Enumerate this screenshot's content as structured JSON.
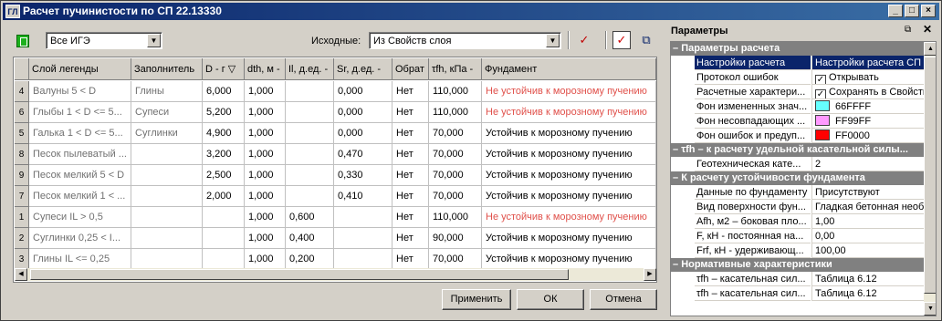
{
  "window": {
    "title": "Расчет пучинистости по СП 22.13330",
    "app_icon": "ГЛ"
  },
  "toolbar": {
    "ige_select": "Все ИГЭ",
    "source_label": "Исходные:",
    "source_select": "Из Свойств слоя"
  },
  "table": {
    "headers": [
      "Слой легенды",
      "Заполнитель",
      "D - г ▽",
      "dth, м -",
      "Il, д.ед. -",
      "Sr, д.ед. -",
      "Обрат",
      "τfh, кПа -",
      "Фундамент"
    ],
    "rows": [
      {
        "n": "4",
        "layer": "Валуны 5 < D",
        "filler": "Глины",
        "d": "6,000",
        "dth": "1,000",
        "il": "",
        "sr": "0,000",
        "obr": "Нет",
        "tfh": "110,000",
        "fund": "Не устойчив к морозному пучению",
        "fund_red": true
      },
      {
        "n": "6",
        "layer": "Глыбы 1 < D <= 5...",
        "filler": "Супеси",
        "d": "5,200",
        "dth": "1,000",
        "il": "",
        "sr": "0,000",
        "obr": "Нет",
        "tfh": "110,000",
        "fund": "Не устойчив к морозному пучению",
        "fund_red": true
      },
      {
        "n": "5",
        "layer": "Галька 1 < D <= 5...",
        "filler": "Суглинки",
        "d": "4,900",
        "dth": "1,000",
        "il": "",
        "sr": "0,000",
        "obr": "Нет",
        "tfh": "70,000",
        "fund": "Устойчив к морозному пучению",
        "fund_red": false
      },
      {
        "n": "8",
        "layer": "Песок пылеватый ...",
        "filler": "",
        "d": "3,200",
        "dth": "1,000",
        "il": "",
        "sr": "0,470",
        "obr": "Нет",
        "tfh": "70,000",
        "fund": "Устойчив к морозному пучению",
        "fund_red": false
      },
      {
        "n": "9",
        "layer": "Песок мелкий 5 < D",
        "filler": "",
        "d": "2,500",
        "dth": "1,000",
        "il": "",
        "sr": "0,330",
        "obr": "Нет",
        "tfh": "70,000",
        "fund": "Устойчив к морозному пучению",
        "fund_red": false
      },
      {
        "n": "7",
        "layer": "Песок мелкий 1 < ...",
        "filler": "",
        "d": "2,000",
        "dth": "1,000",
        "il": "",
        "sr": "0,410",
        "obr": "Нет",
        "tfh": "70,000",
        "fund": "Устойчив к морозному пучению",
        "fund_red": false
      },
      {
        "n": "1",
        "layer": "Супеси IL > 0,5",
        "filler": "",
        "d": "",
        "dth": "1,000",
        "il": "0,600",
        "sr": "",
        "obr": "Нет",
        "tfh": "110,000",
        "fund": "Не устойчив к морозному пучению",
        "fund_red": true
      },
      {
        "n": "2",
        "layer": "Суглинки 0,25 < I...",
        "filler": "",
        "d": "",
        "dth": "1,000",
        "il": "0,400",
        "sr": "",
        "obr": "Нет",
        "tfh": "90,000",
        "fund": "Устойчив к морозному пучению",
        "fund_red": false
      },
      {
        "n": "3",
        "layer": "Глины IL <= 0,25",
        "filler": "",
        "d": "",
        "dth": "1,000",
        "il": "0,200",
        "sr": "",
        "obr": "Нет",
        "tfh": "70,000",
        "fund": "Устойчив к морозному пучению",
        "fund_red": false
      }
    ]
  },
  "buttons": {
    "apply": "Применить",
    "ok": "ОК",
    "cancel": "Отмена"
  },
  "params": {
    "title": "Параметры",
    "cat1": "Параметры расчета",
    "p_settings_name": "Настройки расчета",
    "p_settings_val": "Настройки расчета СП ...",
    "p_proto_name": "Протокол ошибок",
    "p_proto_val": "Открывать",
    "p_calc_name": "Расчетные характери...",
    "p_calc_val": "Сохранять в Свойства",
    "p_fon1_name": "Фон измененных знач...",
    "p_fon1_val": "66FFFF",
    "p_fon2_name": "Фон несовпадающих ...",
    "p_fon2_val": "FF99FF",
    "p_fon3_name": "Фон ошибок и предуп...",
    "p_fon3_val": "FF0000",
    "cat2": "τfh – к расчету удельной касательной силы...",
    "p_geo_name": "Геотехническая кате...",
    "p_geo_val": "2",
    "cat3": "К расчету устойчивости фундамента",
    "p_fdata_name": "Данные по фундаменту",
    "p_fdata_val": "Присутствуют",
    "p_surf_name": "Вид поверхности фун...",
    "p_surf_val": "Гладкая бетонная необ...",
    "p_afh_name": "Afh, м2 – боковая пло...",
    "p_afh_val": "1,00",
    "p_f_name": "F, кН - постоянная на...",
    "p_f_val": "0,00",
    "p_frf_name": "Frf, кН - удерживающ...",
    "p_frf_val": "100,00",
    "cat4": "Нормативные характеристики",
    "p_tfh1_name": "τfh – касательная сил...",
    "p_tfh1_val": "Таблица 6.12",
    "p_tfh2_name": "τfh – касательная сил...",
    "p_tfh2_val": "Таблица 6.12"
  },
  "colors": {
    "fon1": "#66FFFF",
    "fon2": "#FF99FF",
    "fon3": "#FF0000",
    "title_bg": "#0a246a",
    "unstable_text": "#e0504a"
  }
}
